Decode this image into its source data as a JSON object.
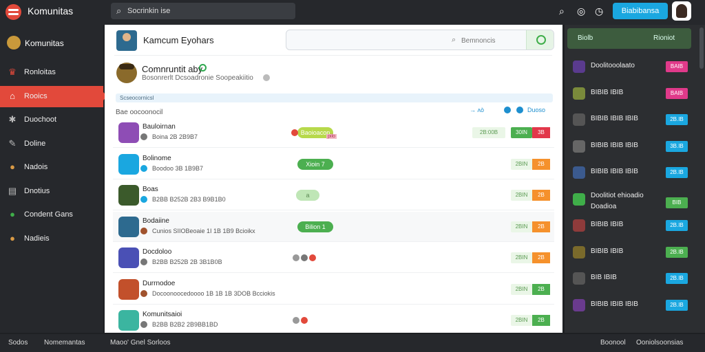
{
  "topbar": {
    "brand": "Komunitas",
    "search_placeholder": "Socrinkin ise",
    "cta_label": "Biabibansa"
  },
  "sidebar": {
    "header": "Komunitas",
    "items": [
      {
        "label": "Ronloitas",
        "icon": "trophy-icon",
        "icon_color": "#e2493b"
      },
      {
        "label": "Rooics",
        "icon": "home-icon",
        "icon_color": "#ffffff",
        "active": true
      },
      {
        "label": "Duochoot",
        "icon": "puzzle-icon",
        "icon_color": "#bbbbbb"
      },
      {
        "label": "Doline",
        "icon": "edit-icon",
        "icon_color": "#bbbbbb"
      },
      {
        "label": "Nadois",
        "icon": "game-avatar-icon",
        "icon_color": "#d99a45"
      },
      {
        "label": "Dnotius",
        "icon": "chart-icon",
        "icon_color": "#bbbbbb"
      },
      {
        "label": "Condent Gans",
        "icon": "green-circle-icon",
        "icon_color": "#3fae49"
      },
      {
        "label": "Nadieis",
        "icon": "game-avatar-icon",
        "icon_color": "#d99a45"
      }
    ]
  },
  "main": {
    "title": "Kamcum Eyohars",
    "search_placeholder": "Bemnoncis",
    "community": {
      "title": "Comnruntit aby",
      "subtitle": "Bosonrerlt Dcsoadronie Soopeakiitio"
    },
    "notice": "Scseocornicsl",
    "list_label": "Bae oocoonocil",
    "controls": {
      "a": "→ ʌò",
      "b": "Duoso"
    },
    "rows": [
      {
        "name": "Bauloirnan",
        "meta": "Boina 2B 2B9B7",
        "avatar_color": "#8e4db5",
        "badge_color": "#777777",
        "pill": "Baoioacon",
        "pill_style": "lime",
        "pill_tag": "pilo",
        "dots": [
          "#e2493b"
        ],
        "count": "2B:00B",
        "btn": "3B",
        "btn_style": "r",
        "count2": "30IN"
      },
      {
        "name": "Bolinome",
        "meta": "Boodoo 3B 1B9B7",
        "avatar_color": "#1aa7e0",
        "badge_color": "#1aa7e0",
        "pill": "Xioin 7",
        "pill_style": "g",
        "dots": [],
        "count": "2BIN",
        "btn": "2B",
        "btn_style": "o"
      },
      {
        "name": "Boas",
        "meta": "B2BB B252B 2B3 B9B1B0",
        "avatar_color": "#3b5a2b",
        "badge_color": "#1aa7e0",
        "pill": "a",
        "pill_style": "lg",
        "dots": [],
        "count": "2BIN",
        "btn": "2B",
        "btn_style": "o"
      },
      {
        "name": "Bodaiine",
        "meta": "Cunios SIIOBeoaie 1I 1B 1B9 Bcioikx",
        "avatar_color": "#2d6a8f",
        "badge_color": "#a0522d",
        "pill": "Bilion 1",
        "pill_style": "g",
        "dots": [],
        "count": "2BIN",
        "btn": "2B",
        "btn_style": "o",
        "alt": true
      },
      {
        "name": "Docdoloo",
        "meta": "B2BB B252B 2B 3B1B0B",
        "avatar_color": "#4a50b5",
        "badge_color": "#777777",
        "pill": "",
        "pill_style": "",
        "dots": [
          "#999999",
          "#777777",
          "#e2493b"
        ],
        "count": "2BIN",
        "btn": "2B",
        "btn_style": "o"
      },
      {
        "name": "Durrnodoe",
        "meta": "Docoonoocedoooo 1B 1B 1B 3DOB Bcciokis",
        "avatar_color": "#c2502b",
        "badge_color": "#a0522d",
        "pill": "",
        "pill_style": "",
        "dots": [],
        "count": "2BIN",
        "btn": "2B",
        "btn_style": "gr"
      },
      {
        "name": "Komunitsaioi",
        "meta": "B2BB B2B2 2B9BB1BD",
        "avatar_color": "#3bb5a0",
        "badge_color": "#777777",
        "pill": "",
        "pill_style": "",
        "dots": [
          "#999999",
          "#e2493b"
        ],
        "count": "2BIN",
        "btn": "2B",
        "btn_style": "gr"
      }
    ]
  },
  "rail": {
    "head_a": "Biolb",
    "head_b": "Rioniot",
    "rows": [
      {
        "text": "Doolitooolaato",
        "icon_color": "#5a3b8e",
        "btn": "BAIB",
        "btn_style": "pink"
      },
      {
        "text": "BIBIB IBIB",
        "icon_color": "#7a8a3b",
        "btn": "BAIB",
        "btn_style": "pink"
      },
      {
        "text": "BIBIB IBIB IBIB",
        "icon_color": "#555555",
        "btn": "2B.IB",
        "btn_style": "blue"
      },
      {
        "text": "BIBIB IBIB IBIB",
        "icon_color": "#666666",
        "btn": "3B.IB",
        "btn_style": "blue"
      },
      {
        "text": "BIBIB IBIB IBIB",
        "icon_color": "#3b5a8e",
        "btn": "2B.IB",
        "btn_style": "blue"
      },
      {
        "text": "Doolitiot ehioadio",
        "text2": "Doadioa",
        "icon_color": "#3fae49",
        "btn": "BIB",
        "btn_style": "green",
        "two": true
      },
      {
        "text": "BIBIB IBIB",
        "icon_color": "#8e3b3b",
        "btn": "2B.IB",
        "btn_style": "blue"
      },
      {
        "text": "BIBIB IBIB",
        "icon_color": "#7a6a2b",
        "btn": "2B.IB",
        "btn_style": "green"
      },
      {
        "text": "BIB IBIB",
        "icon_color": "#555555",
        "btn": "2B.IB",
        "btn_style": "blue"
      },
      {
        "text": "BIBIB IBIB IBIB",
        "icon_color": "#6a3b8e",
        "btn": "2B.IB",
        "btn_style": "blue"
      }
    ]
  },
  "bottombar": {
    "a": "Sodos",
    "b": "Nomemantas",
    "c": "Maoo' Gnel Sorloos",
    "d": "Boonool",
    "e": "Ooniolsoonsias"
  },
  "colors": {
    "accent": "#e2493b",
    "primary": "#1aa7e0",
    "success": "#4caf50"
  }
}
